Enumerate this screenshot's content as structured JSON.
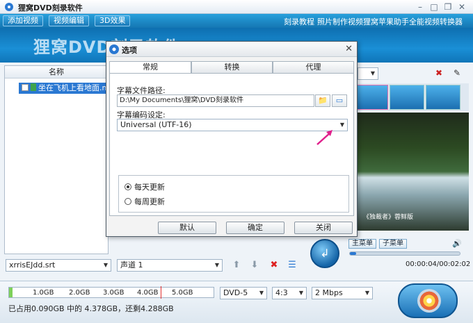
{
  "app": {
    "title": "狸窝DVD刻录软件",
    "banner_text": "狸窝DVD刻录软件"
  },
  "menubar": {
    "buttons": [
      "添加视频",
      "视频编辑",
      "3D效果"
    ],
    "links": [
      "刻录教程",
      "照片制作视频",
      "狸窝苹果助手",
      "全能视频转换器"
    ]
  },
  "left_panel": {
    "column_header": "名称",
    "file_name": "坐在飞机上看地面.mp4"
  },
  "bottom_toolbar": {
    "subtitle_file": "xrrisEJdd.srt",
    "audio_track": "声道 1"
  },
  "player": {
    "main_menu_button": "主菜单",
    "sub_menu_button": "子菜单",
    "time": "00:00:04/00:02:02",
    "progress": 0.06,
    "video_caption": "《独裁者》蓉鲜版"
  },
  "capacity_bar": {
    "ticks": [
      "1.0GB",
      "2.0GB",
      "3.0GB",
      "4.0GB",
      "5.0GB"
    ],
    "used_fraction": 0.016,
    "usage_text": "已占用0.090GB 中的 4.378GB，还剩4.288GB"
  },
  "output_settings": {
    "disc_type": "DVD-5",
    "aspect_ratio": "4:3",
    "bitrate": "2 Mbps"
  },
  "dialog": {
    "title": "选项",
    "tabs": [
      "常规",
      "转换",
      "代理"
    ],
    "active_tab": "常规",
    "subtitle_path_label": "字幕文件路径:",
    "subtitle_path_value": "D:\\My Documents\\狸窝\\DVD刻录软件",
    "encoding_label": "字幕编码设定:",
    "encoding_value": "Universal (UTF-16)",
    "update_daily": "每天更新",
    "update_weekly": "每周更新",
    "buttons": {
      "default": "默认",
      "ok": "确定",
      "close": "关闭"
    }
  },
  "colors": {
    "accent": "#1a7ab8",
    "selection": "#2a78d2",
    "pointer": "#e0208c"
  }
}
